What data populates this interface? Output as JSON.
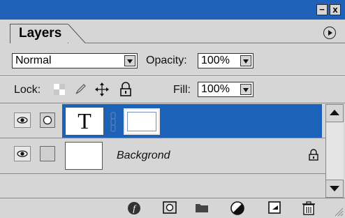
{
  "panel": {
    "tab_label": "Layers",
    "window_buttons": {
      "minimize": "−",
      "close": "x"
    }
  },
  "blend": {
    "mode": "Normal"
  },
  "opacity": {
    "label": "Opacity:",
    "value": "100%"
  },
  "lock": {
    "label": "Lock:"
  },
  "fill": {
    "label": "Fill:",
    "value": "100%"
  },
  "layers": [
    {
      "name": "",
      "type_glyph": "T",
      "selected": true
    },
    {
      "name": "Backgrond",
      "locked": true,
      "selected": false
    }
  ],
  "colors": {
    "accent": "#2061b9",
    "selection": "#1c62b8",
    "panel": "#d6d6d6"
  }
}
